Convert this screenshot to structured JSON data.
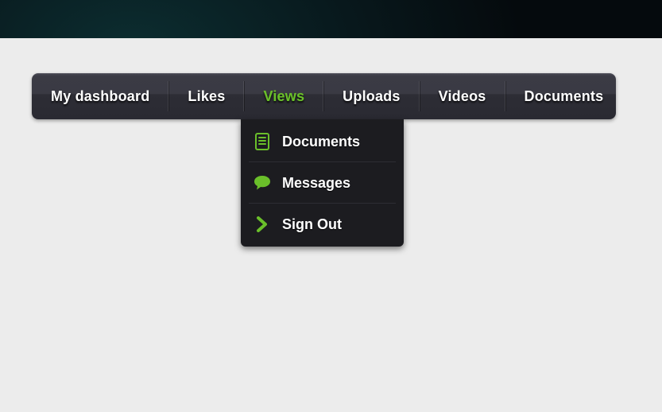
{
  "colors": {
    "accent": "#6abf2a",
    "nav_text": "#ffffff",
    "dropdown_bg": "#1c1c20"
  },
  "nav": {
    "items": [
      {
        "label": "My dashboard"
      },
      {
        "label": "Likes"
      },
      {
        "label": "Views"
      },
      {
        "label": "Uploads"
      },
      {
        "label": "Videos"
      },
      {
        "label": "Documents"
      }
    ],
    "active_index": 2
  },
  "dropdown": {
    "items": [
      {
        "label": "Documents",
        "icon": "document-icon"
      },
      {
        "label": "Messages",
        "icon": "chat-icon"
      },
      {
        "label": "Sign Out",
        "icon": "chevron-right-icon"
      }
    ]
  }
}
